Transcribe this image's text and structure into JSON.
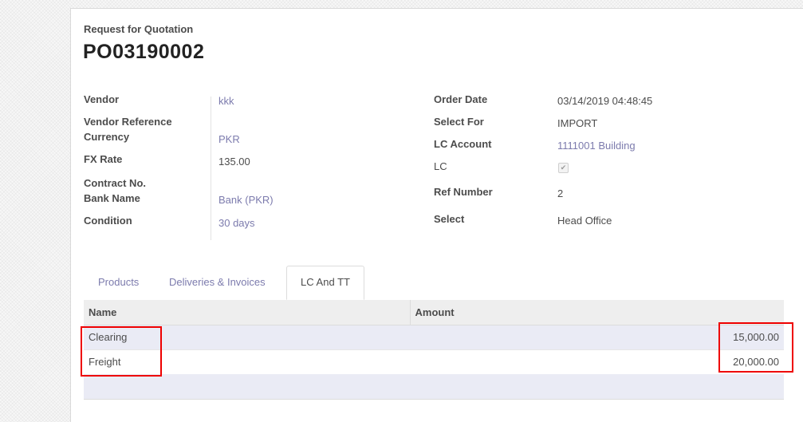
{
  "header": {
    "doc_type": "Request for Quotation",
    "doc_name": "PO03190002"
  },
  "left_fields": {
    "vendor": {
      "label": "Vendor",
      "value": "kkk"
    },
    "vendor_reference": {
      "label": "Vendor Reference",
      "value": ""
    },
    "currency": {
      "label": "Currency",
      "value": "PKR"
    },
    "fx_rate": {
      "label": "FX Rate",
      "value": "135.00"
    },
    "contract_no": {
      "label": "Contract No.",
      "value": ""
    },
    "bank_name": {
      "label": "Bank Name",
      "value": "Bank (PKR)"
    },
    "condition": {
      "label": "Condition",
      "value": "30 days"
    }
  },
  "right_fields": {
    "order_date": {
      "label": "Order Date",
      "value": "03/14/2019 04:48:45"
    },
    "select_for": {
      "label": "Select For",
      "value": "IMPORT"
    },
    "lc_account": {
      "label": "LC Account",
      "value": "1111001 Building"
    },
    "lc": {
      "label": "LC",
      "checked": true,
      "check_glyph": "✔"
    },
    "ref_number": {
      "label": "Ref Number",
      "value": "2"
    },
    "select": {
      "label": "Select",
      "value": "Head Office"
    }
  },
  "tabs": [
    {
      "label": "Products",
      "active": false
    },
    {
      "label": "Deliveries & Invoices",
      "active": false
    },
    {
      "label": "LC And TT",
      "active": true
    }
  ],
  "table": {
    "columns": [
      "Name",
      "Amount"
    ],
    "rows": [
      {
        "name": "Clearing",
        "amount": "15,000.00"
      },
      {
        "name": "Freight",
        "amount": "20,000.00"
      }
    ]
  },
  "colors": {
    "link": "#7c7bad",
    "highlight": "#ee0000",
    "row_tint": "#eaebf5"
  }
}
